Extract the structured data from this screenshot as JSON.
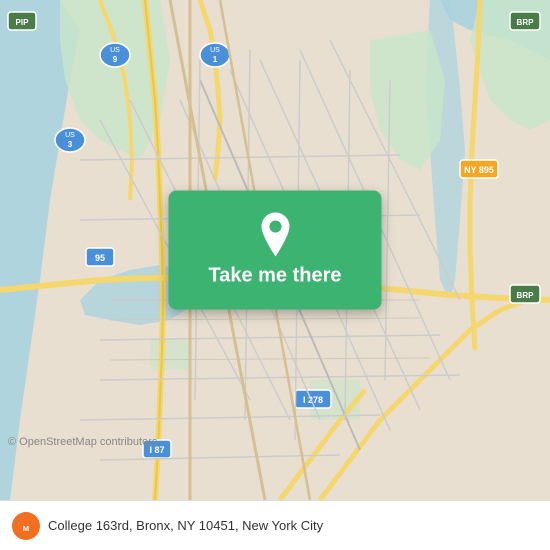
{
  "map": {
    "alt": "Map of Bronx, New York City",
    "center_lat": 40.83,
    "center_lon": -73.92
  },
  "button": {
    "label": "Take me there"
  },
  "footer": {
    "address": "College 163rd, Bronx, NY 10451, New York City",
    "logo_alt": "Moovit logo"
  },
  "osm": {
    "credit": "© OpenStreetMap contributors"
  },
  "icons": {
    "pin": "location-pin-icon",
    "moovit": "moovit-logo-icon"
  }
}
